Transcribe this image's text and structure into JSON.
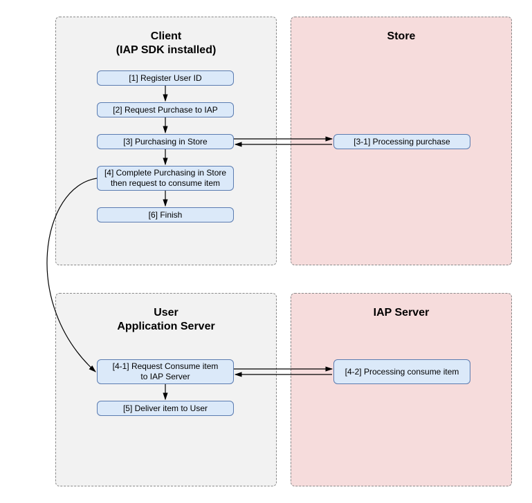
{
  "containers": {
    "client": {
      "title_line1": "Client",
      "title_line2": "(IAP SDK installed)"
    },
    "store": {
      "title": "Store"
    },
    "user_server": {
      "title_line1": "User",
      "title_line2": "Application Server"
    },
    "iap_server": {
      "title": "IAP Server"
    }
  },
  "steps": {
    "s1": "[1] Register User ID",
    "s2": "[2] Request Purchase to IAP",
    "s3": "[3] Purchasing in Store",
    "s3_1": "[3-1] Processing purchase",
    "s4_line1": "[4] Complete Purchasing in Store",
    "s4_line2": "then request to consume item",
    "s4_1_line1": "[4-1] Request Consume item",
    "s4_1_line2": "to IAP Server",
    "s4_2": "[4-2] Processing consume item",
    "s5": "[5] Deliver item to User",
    "s6": "[6] Finish"
  }
}
